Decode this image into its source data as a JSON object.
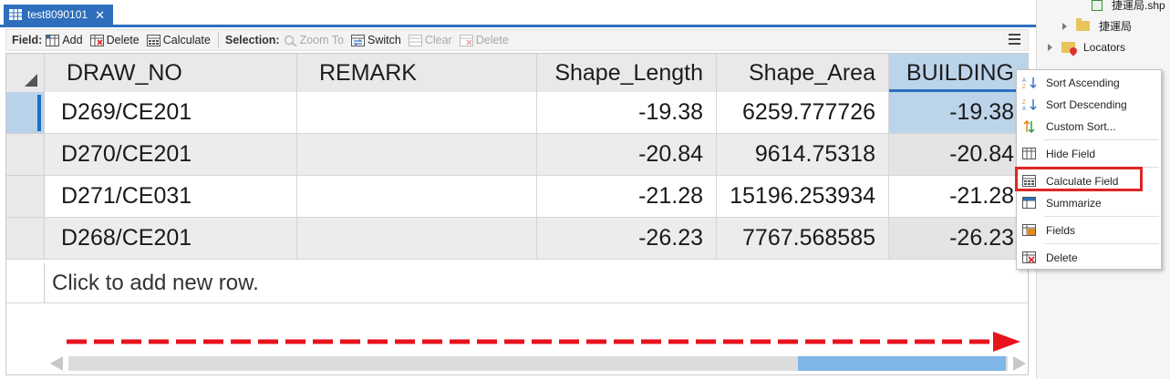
{
  "tab": {
    "title": "test8090101",
    "close": "✕"
  },
  "toolbar": {
    "field_label": "Field:",
    "add": "Add",
    "delete": "Delete",
    "calculate": "Calculate",
    "selection_label": "Selection:",
    "zoom_to": "Zoom To",
    "switch": "Switch",
    "clear": "Clear",
    "sel_delete": "Delete"
  },
  "table": {
    "columns": [
      "DRAW_NO",
      "REMARK",
      "Shape_Length",
      "Shape_Area",
      "BUILDING"
    ],
    "rows": [
      [
        "D269/CE201",
        "",
        "-19.38",
        "6259.777726",
        "-19.38"
      ],
      [
        "D270/CE201",
        "",
        "-20.84",
        "9614.75318",
        "-20.84"
      ],
      [
        "D271/CE031",
        "",
        "-21.28",
        "15196.253934",
        "-21.28"
      ],
      [
        "D268/CE201",
        "",
        "-26.23",
        "7767.568585",
        "-26.23"
      ]
    ],
    "new_row": "Click to add new row."
  },
  "tree": {
    "shp": "捷運局.shp",
    "folder": "捷運局",
    "locators": "Locators"
  },
  "context_menu": {
    "sort_ascending": "Sort Ascending",
    "sort_descending": "Sort Descending",
    "custom_sort": "Custom Sort...",
    "hide_field": "Hide Field",
    "calculate_field": "Calculate Field",
    "summarize": "Summarize",
    "fields": "Fields",
    "delete": "Delete"
  },
  "colors": {
    "accent": "#2e6fbd",
    "selected_column": "#bcd4ea",
    "annotation_red": "#e8121c"
  }
}
